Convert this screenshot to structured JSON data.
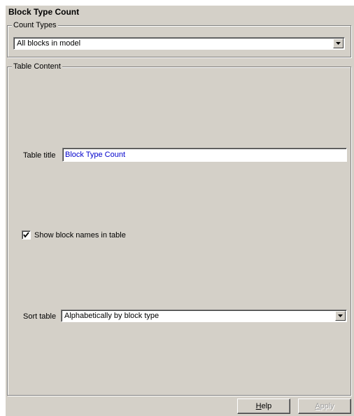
{
  "heading": "Block Type Count",
  "count_types": {
    "legend": "Count Types",
    "selected": "All blocks in model"
  },
  "table_content": {
    "legend": "Table Content",
    "table_title_label": "Table title",
    "table_title_value": "Block Type Count",
    "show_names_label": "Show block names in table",
    "show_names_checked": true,
    "sort_label": "Sort table",
    "sort_selected": "Alphabetically by block type"
  },
  "buttons": {
    "help_mnemonic": "H",
    "help_rest": "elp",
    "apply_mnemonic": "A",
    "apply_rest": "pply"
  }
}
